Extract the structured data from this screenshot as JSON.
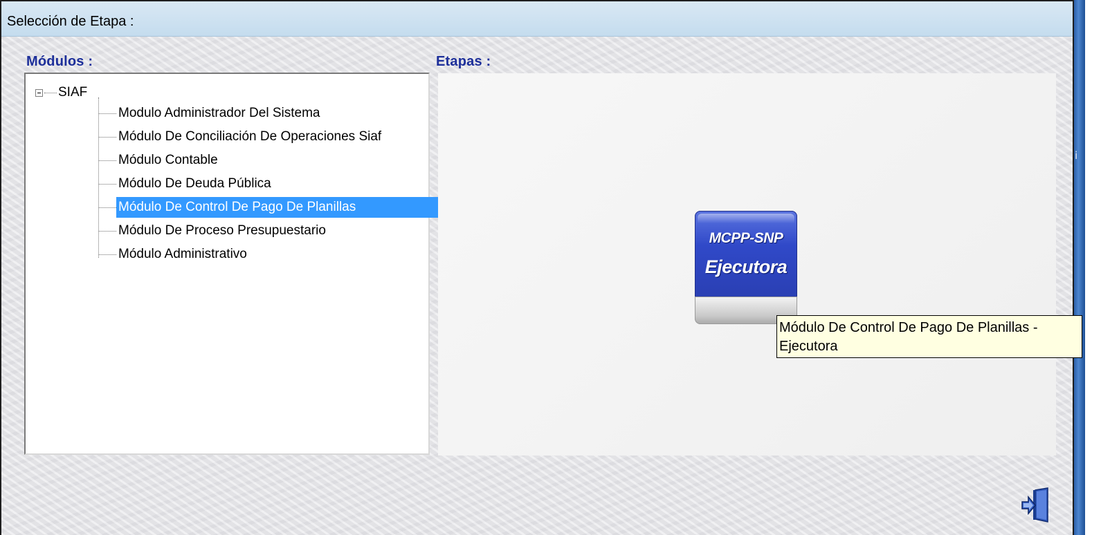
{
  "window": {
    "title": "Selección de Etapa :"
  },
  "modules_panel": {
    "label": "Módulos :",
    "root": {
      "label": "SIAF",
      "expanded": true
    },
    "items": [
      {
        "label": "Modulo Administrador Del Sistema",
        "selected": false
      },
      {
        "label": "Módulo De Conciliación De Operaciones Siaf",
        "selected": false
      },
      {
        "label": "Módulo Contable",
        "selected": false
      },
      {
        "label": "Módulo De Deuda Pública",
        "selected": false
      },
      {
        "label": "Módulo De Control De Pago De Planillas",
        "selected": true
      },
      {
        "label": "Módulo De Proceso Presupuestario",
        "selected": false
      },
      {
        "label": "Módulo Administrativo",
        "selected": false
      }
    ]
  },
  "stages_panel": {
    "label": "Etapas :",
    "stage": {
      "line1": "MCPP-SNP",
      "line2": "Ejecutora"
    },
    "tooltip": "Módulo De Control De Pago De Planillas - Ejecutora"
  },
  "side_glyph": "i",
  "exit_icon": "exit-door-icon",
  "colors": {
    "title_bar": "#c8def0",
    "section_label": "#1d2f9a",
    "selection": "#3399ff",
    "stage_blue": "#3049c8",
    "tooltip_bg": "#ffffe1"
  }
}
